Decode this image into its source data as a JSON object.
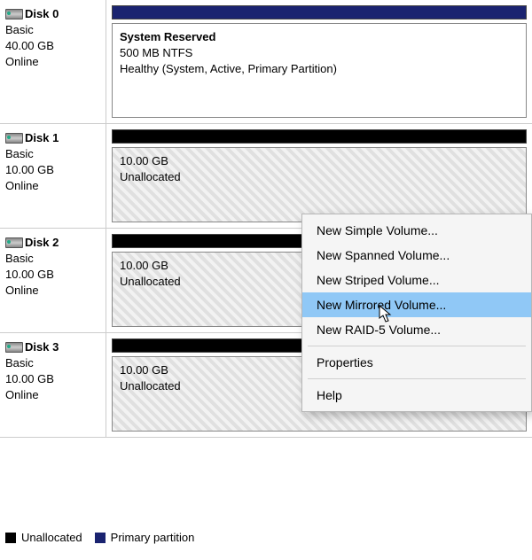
{
  "disks": [
    {
      "name": "Disk 0",
      "type": "Basic",
      "size": "40.00 GB",
      "status": "Online",
      "volume": {
        "bar_kind": "primary",
        "title": "System Reserved",
        "line2": "500 MB NTFS",
        "line3": "Healthy (System, Active, Primary Partition)",
        "hatched": false
      }
    },
    {
      "name": "Disk 1",
      "type": "Basic",
      "size": "10.00 GB",
      "status": "Online",
      "volume": {
        "bar_kind": "black",
        "title": "",
        "line2": "10.00 GB",
        "line3": "Unallocated",
        "hatched": true
      }
    },
    {
      "name": "Disk 2",
      "type": "Basic",
      "size": "10.00 GB",
      "status": "Online",
      "volume": {
        "bar_kind": "black",
        "title": "",
        "line2": "10.00 GB",
        "line3": "Unallocated",
        "hatched": true
      }
    },
    {
      "name": "Disk 3",
      "type": "Basic",
      "size": "10.00 GB",
      "status": "Online",
      "volume": {
        "bar_kind": "black",
        "title": "",
        "line2": "10.00 GB",
        "line3": "Unallocated",
        "hatched": true
      }
    }
  ],
  "legend": {
    "unallocated": "Unallocated",
    "primary": "Primary partition"
  },
  "context_menu": {
    "items": [
      "New Simple Volume...",
      "New Spanned Volume...",
      "New Striped Volume...",
      "New Mirrored Volume...",
      "New RAID-5 Volume..."
    ],
    "items2": [
      "Properties"
    ],
    "items3": [
      "Help"
    ],
    "highlighted_index": 3
  }
}
